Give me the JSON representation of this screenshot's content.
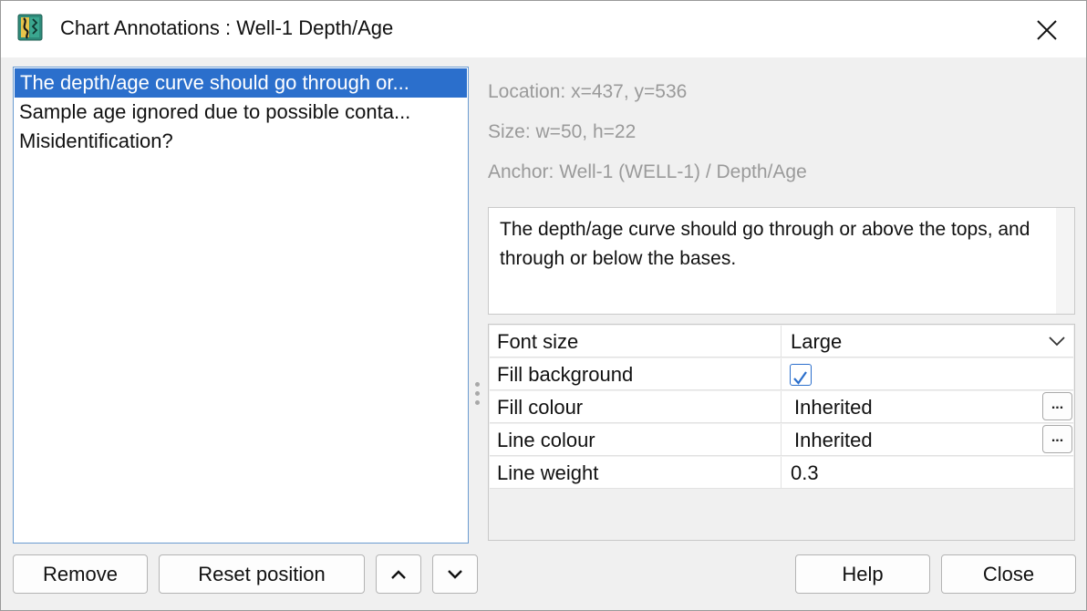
{
  "window": {
    "title": "Chart Annotations : Well-1 Depth/Age",
    "app_icon": "app-logo-icon",
    "close_icon": "close-icon"
  },
  "annotations": {
    "items": [
      {
        "label": "The depth/age curve should go through or...",
        "selected": true
      },
      {
        "label": "Sample age ignored due to possible conta...",
        "selected": false
      },
      {
        "label": "Misidentification?",
        "selected": false
      }
    ]
  },
  "details": {
    "location": "Location: x=437, y=536",
    "size": "Size: w=50, h=22",
    "anchor": "Anchor: Well-1 (WELL-1) / Depth/Age",
    "text": "The depth/age curve should go through or above the tops, and through or below the bases."
  },
  "properties": {
    "font_size": {
      "name": "Font size",
      "value": "Large"
    },
    "fill_background": {
      "name": "Fill background",
      "checked": true
    },
    "fill_colour": {
      "name": "Fill colour",
      "value": "Inherited",
      "button": "..."
    },
    "line_colour": {
      "name": "Line colour",
      "value": "Inherited",
      "button": "..."
    },
    "line_weight": {
      "name": "Line weight",
      "value": "0.3"
    }
  },
  "buttons": {
    "remove": "Remove",
    "reset_position": "Reset position",
    "move_up_icon": "chevron-up-icon",
    "move_down_icon": "chevron-down-icon",
    "help": "Help",
    "close": "Close"
  },
  "colors": {
    "selection": "#2b6fcc",
    "list_border": "#6a9bd1",
    "checkbox_accent": "#2b6fcc"
  }
}
